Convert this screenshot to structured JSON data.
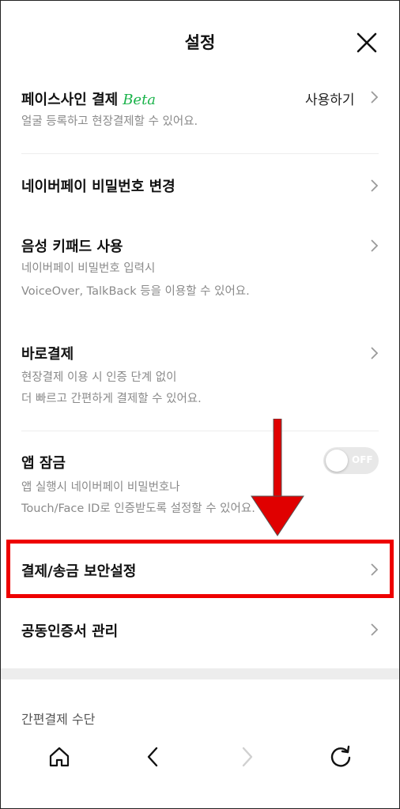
{
  "header": {
    "title": "설정"
  },
  "items": [
    {
      "title": "페이스사인 결제",
      "badge": "Beta",
      "value": "사용하기",
      "desc": [
        "얼굴 등록하고 현장결제할 수 있어요."
      ]
    },
    {
      "title": "네이버페이 비밀번호 변경"
    },
    {
      "title": "음성 키패드 사용",
      "desc": [
        "네이버페이 비밀번호 입력시",
        "VoiceOver, TalkBack 등을 이용할 수 있어요."
      ]
    },
    {
      "title": "바로결제",
      "desc": [
        "현장결제 이용 시 인증 단계 없이",
        "더 빠르고 간편하게 결제할 수 있어요."
      ]
    },
    {
      "title": "앱 잠금",
      "toggle": "OFF",
      "desc": [
        "앱 실행시 네이버페이 비밀번호나",
        "Touch/Face ID로 인증받도록 설정할 수 있어요."
      ]
    },
    {
      "title": "결제/송금 보안설정"
    },
    {
      "title": "공동인증서 관리"
    }
  ],
  "section": {
    "title": "간편결제 수단"
  },
  "colors": {
    "beta_green": "#1ab34a",
    "highlight_red": "#ee0000",
    "divider": "#ededed"
  },
  "icons": [
    "close-icon",
    "chevron-right-icon",
    "home-icon",
    "back-icon",
    "forward-icon",
    "refresh-icon"
  ]
}
